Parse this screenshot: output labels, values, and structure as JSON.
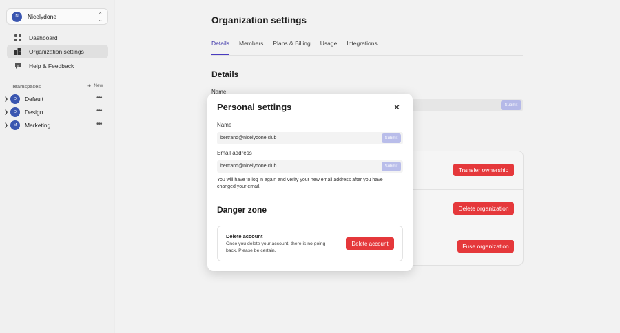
{
  "sidebar": {
    "org": {
      "initial": "N",
      "name": "Nicelydone"
    },
    "nav": [
      {
        "label": "Dashboard",
        "icon": "grid-icon"
      },
      {
        "label": "Organization settings",
        "icon": "buildings-icon"
      },
      {
        "label": "Help & Feedback",
        "icon": "chat-icon"
      }
    ],
    "teamspaces_label": "Teamspaces",
    "new_label": "New",
    "teams": [
      {
        "initial": "D",
        "name": "Default"
      },
      {
        "initial": "D",
        "name": "Design"
      },
      {
        "initial": "M",
        "name": "Marketing"
      }
    ]
  },
  "main": {
    "title": "Organization settings",
    "tabs": [
      "Details",
      "Members",
      "Plans & Billing",
      "Usage",
      "Integrations"
    ],
    "active_tab": "Details",
    "details_title": "Details",
    "name_label": "Name",
    "submit_label": "Submit",
    "danger_buttons": [
      "Transfer ownership",
      "Delete organization",
      "Fuse organization"
    ]
  },
  "modal": {
    "title": "Personal settings",
    "name_label": "Name",
    "name_value": "bertrand@nicelydone.club",
    "email_label": "Email address",
    "email_value": "bertrand@nicelydone.club",
    "submit_label": "Submit",
    "help_text": "You will have to log in again and verify your new email address after you have changed your email.",
    "danger_title": "Danger zone",
    "delete_title": "Delete account",
    "delete_desc": "Once you delete your account, there is no going back. Please be certain.",
    "delete_button": "Delete account"
  },
  "colors": {
    "accent": "#4a3cc0",
    "danger": "#e5383b",
    "avatar": "#3a56b0",
    "submit": "#b9bdea"
  }
}
